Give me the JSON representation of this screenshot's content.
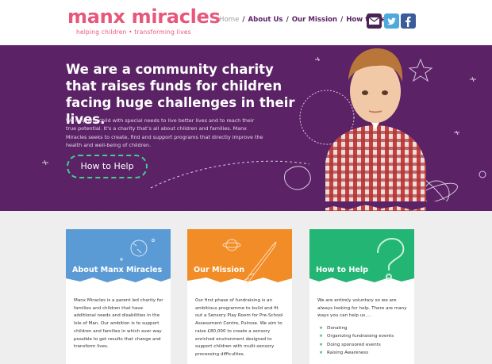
{
  "logo": {
    "title": "manx miracles",
    "tagline": "helping children • transforming lives"
  },
  "nav": {
    "items": [
      {
        "label": "Home",
        "active": true
      },
      {
        "label": "About Us",
        "active": false
      },
      {
        "label": "Our Mission",
        "active": false
      },
      {
        "label": "How to Help",
        "active": false
      }
    ],
    "separator": "/"
  },
  "social": [
    {
      "name": "mail-icon"
    },
    {
      "name": "twitter-icon"
    },
    {
      "name": "facebook-icon"
    }
  ],
  "hero": {
    "heading": "We are a community charity that raises funds for children facing huge challenges in their lives.",
    "body": "We help any child with special needs to live better lives and to reach their true potential. It’s a charity that’s all about children and families. Manx Miracles seeks to create, find and support programs that directly improve the health and well-being of children.",
    "cta_label": "How to Help"
  },
  "cards": [
    {
      "title": "About Manx Miracles",
      "color": "#5b9bd5",
      "text": "Manx Miracles is a parent led charity for families and children that have additional needs and disabilities in the Isle of Man. Our ambition is to support children and families in which ever way possible to get results that change and transform lives."
    },
    {
      "title": "Our Mission",
      "color": "#f28c26",
      "text": "Our first phase of fundraising is an ambitious programme to build and fit out a Sensory Play Room for Pre-School Assessment Centre, Pulrose. We aim to raise £80,000 to create a sensory enriched environment designed to support children with multi-sensory processing difficulties."
    },
    {
      "title": "How to Help",
      "color": "#22b573",
      "text": "We are entirely voluntary so we are always looking for help. There are many ways you can help us….",
      "list": [
        "Donating",
        "Organizing fundraising events",
        "Doing sponsored events",
        "Raising Awareness"
      ]
    }
  ]
}
